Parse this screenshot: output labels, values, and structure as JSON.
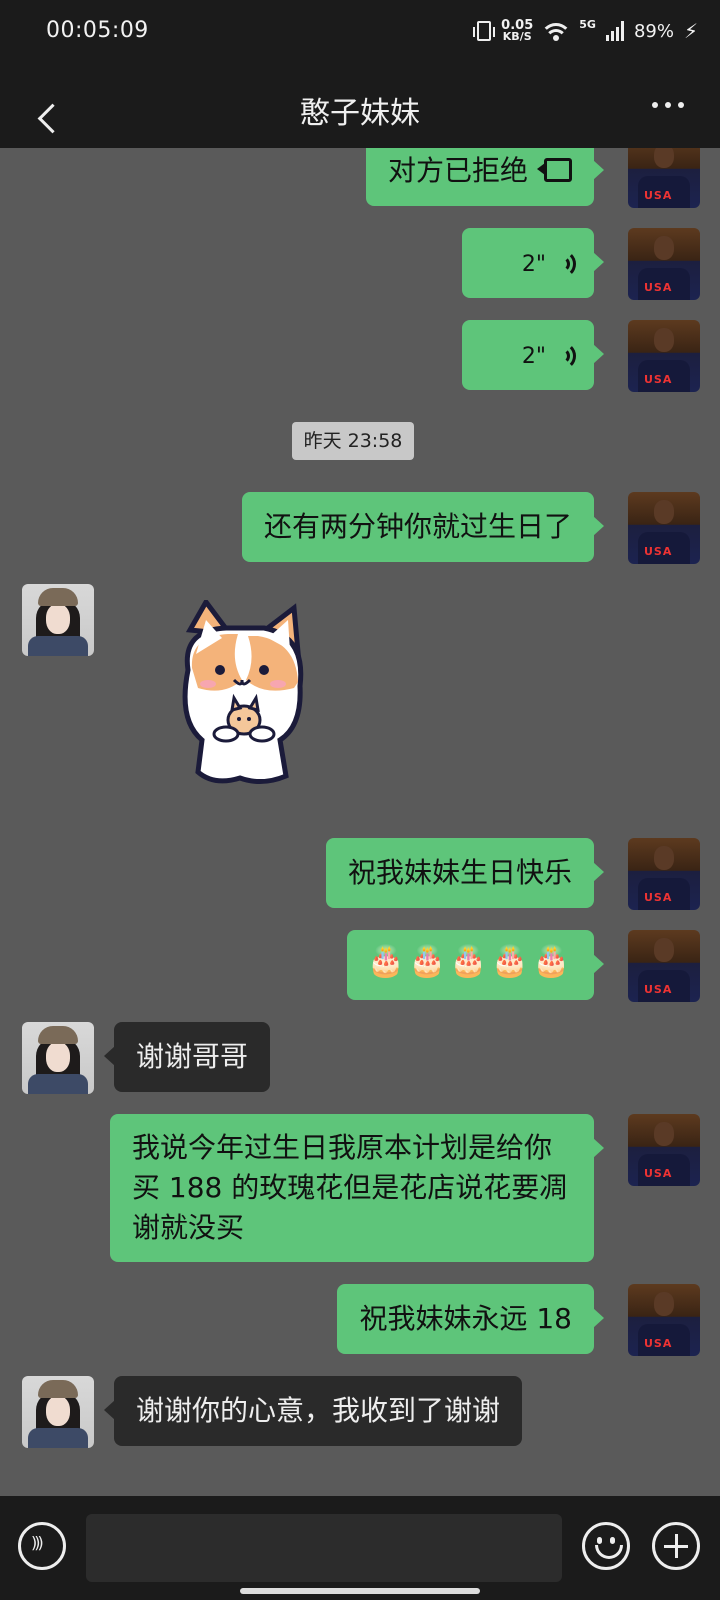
{
  "status_bar": {
    "time": "00:05:09",
    "net_speed_value": "0.05",
    "net_speed_unit": "KB/S",
    "network": "5G",
    "battery": "89%"
  },
  "header": {
    "title": "憨子妹妹"
  },
  "messages": [
    {
      "from": "me",
      "type": "call",
      "text": "对方已拒绝"
    },
    {
      "from": "me",
      "type": "voice",
      "duration": "2\""
    },
    {
      "from": "me",
      "type": "voice",
      "duration": "2\""
    },
    {
      "type": "timestamp",
      "text": "昨天 23:58"
    },
    {
      "from": "me",
      "type": "text",
      "text": "还有两分钟你就过生日了"
    },
    {
      "from": "her",
      "type": "sticker",
      "sticker": "corgi-hugging-kitten"
    },
    {
      "from": "me",
      "type": "text",
      "text": "祝我妹妹生日快乐"
    },
    {
      "from": "me",
      "type": "emoji",
      "text": "🎂🎂🎂🎂🎂"
    },
    {
      "from": "her",
      "type": "text",
      "text": "谢谢哥哥"
    },
    {
      "from": "me",
      "type": "text",
      "text": "我说今年过生日我原本计划是给你买 188 的玫瑰花但是花店说花要凋谢就没买"
    },
    {
      "from": "me",
      "type": "text",
      "text": "祝我妹妹永远 18"
    },
    {
      "from": "her",
      "type": "text",
      "text": "谢谢你的心意，我收到了谢谢"
    }
  ],
  "input_bar": {
    "text_value": ""
  },
  "colors": {
    "my_bubble": "#5ec57a",
    "her_bubble": "#2a2a2a",
    "chat_bg": "#5a5a5a",
    "bar_bg": "#1b1b1b"
  }
}
